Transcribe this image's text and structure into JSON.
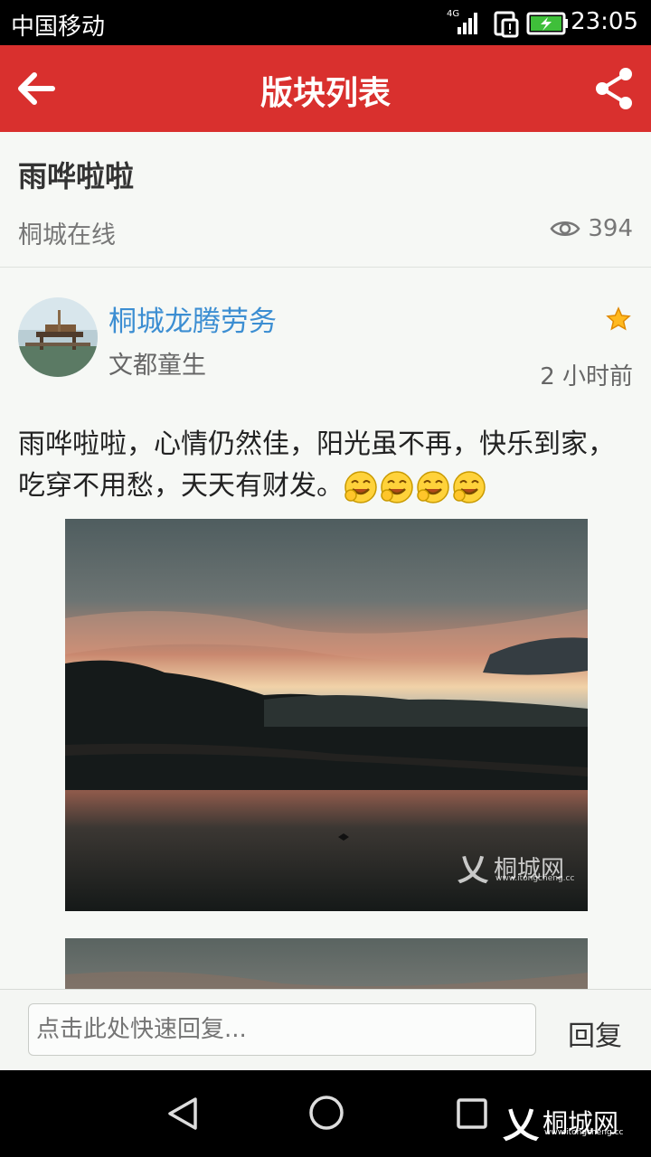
{
  "status_bar": {
    "carrier": "中国移动",
    "network": "4G",
    "time": "23:05"
  },
  "app_bar": {
    "title": "版块列表",
    "back_icon": "arrow-left-icon",
    "share_icon": "share-icon"
  },
  "thread": {
    "title": "雨哗啦啦",
    "forum": "桐城在线",
    "views": "394"
  },
  "post": {
    "author": "桐城龙腾劳务",
    "subname": "文都童生",
    "time_ago": "2 小时前",
    "text": "雨哗啦啦，心情仍然佳，阳光虽不再，快乐到家，吃穿不用愁，天天有财发。",
    "emoji_count": 4,
    "watermark": "桐城网",
    "watermark_sub": "www.itongcheng.cc"
  },
  "reply": {
    "placeholder": "点击此处快速回复...",
    "button": "回复"
  },
  "nav": {
    "logo_text": "桐城网",
    "logo_sub": "www.itongcheng.cc"
  },
  "colors": {
    "brand": "#d9302e",
    "link": "#3c8ed2"
  }
}
